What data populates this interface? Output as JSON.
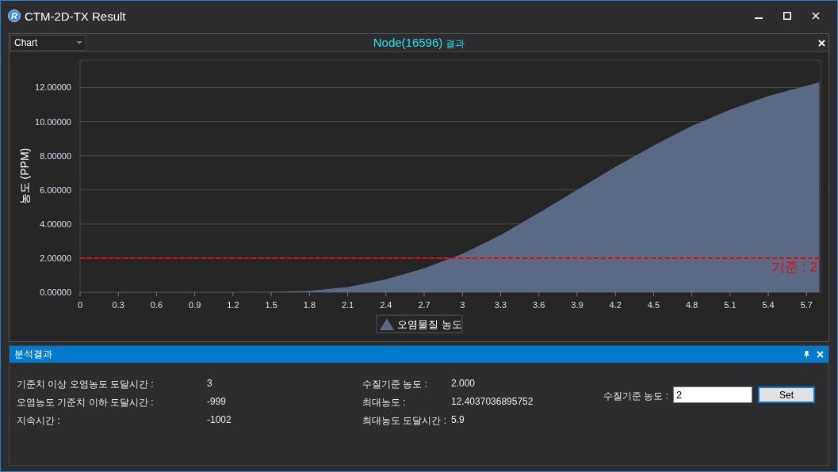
{
  "window": {
    "logo": "R",
    "title": "CTM-2D-TX Result"
  },
  "chart_panel": {
    "view_select": {
      "value": "Chart"
    },
    "title": "Node(16596)",
    "title_suffix": "결과",
    "chart_data": {
      "type": "area",
      "ylabel": "농도 (PPM)",
      "x": [
        0,
        0.3,
        0.6,
        0.9,
        1.2,
        1.5,
        1.8,
        2.1,
        2.4,
        2.7,
        3.0,
        3.3,
        3.6,
        3.9,
        4.2,
        4.5,
        4.8,
        5.1,
        5.4,
        5.7,
        5.8
      ],
      "series": [
        {
          "name": "오염물질 농도",
          "color": "#5a6a85",
          "values": [
            0,
            0,
            0,
            0,
            0,
            0.01,
            0.08,
            0.3,
            0.75,
            1.4,
            2.25,
            3.35,
            4.65,
            6.0,
            7.35,
            8.6,
            9.75,
            10.7,
            11.5,
            12.1,
            12.3
          ]
        }
      ],
      "xlim": [
        0,
        5.81
      ],
      "ylim": [
        0,
        13.6
      ],
      "xticks": [
        {
          "value": 0,
          "label": "0"
        },
        {
          "value": 0.3,
          "label": "0.3"
        },
        {
          "value": 0.6,
          "label": "0.6"
        },
        {
          "value": 0.9,
          "label": "0.9"
        },
        {
          "value": 1.2,
          "label": "1.2"
        },
        {
          "value": 1.5,
          "label": "1.5"
        },
        {
          "value": 1.8,
          "label": "1.8"
        },
        {
          "value": 2.1,
          "label": "2.1"
        },
        {
          "value": 2.4,
          "label": "2.4"
        },
        {
          "value": 2.7,
          "label": "2.7"
        },
        {
          "value": 3,
          "label": "3"
        },
        {
          "value": 3.3,
          "label": "3.3"
        },
        {
          "value": 3.6,
          "label": "3.6"
        },
        {
          "value": 3.9,
          "label": "3.9"
        },
        {
          "value": 4.2,
          "label": "4.2"
        },
        {
          "value": 4.5,
          "label": "4.5"
        },
        {
          "value": 4.8,
          "label": "4.8"
        },
        {
          "value": 5.1,
          "label": "5.1"
        },
        {
          "value": 5.4,
          "label": "5.4"
        },
        {
          "value": 5.7,
          "label": "5.7"
        }
      ],
      "yticks": [
        {
          "value": 0,
          "label": "0.00000"
        },
        {
          "value": 2,
          "label": "2.00000"
        },
        {
          "value": 4,
          "label": "4.00000"
        },
        {
          "value": 6,
          "label": "6.00000"
        },
        {
          "value": 8,
          "label": "8.00000"
        },
        {
          "value": 10,
          "label": "10.00000"
        },
        {
          "value": 12,
          "label": "12.00000"
        }
      ],
      "grid": true,
      "ref_lines": [
        {
          "axis": "y",
          "value": 2,
          "label": "기준 : 2",
          "color": "#ff0000"
        }
      ]
    }
  },
  "result_panel": {
    "title": "분석결과",
    "rows": [
      {
        "label": "기준치 이상 오염농도 도달시간 :",
        "value": "3",
        "label2": "수질기준 농도 :",
        "value2": "2.000"
      },
      {
        "label": "오염농도 기준치 이하 도달시간 :",
        "value": "-999",
        "label2": "최대농도 :",
        "value2": "12.4037036895752"
      },
      {
        "label": "지속시간 :",
        "value": "-1002",
        "label2": "최대농도 도달시간 :",
        "value2": "5.9"
      }
    ],
    "threshold_label": "수질기준 농도 :",
    "threshold_value": "2",
    "set_button": "Set"
  }
}
